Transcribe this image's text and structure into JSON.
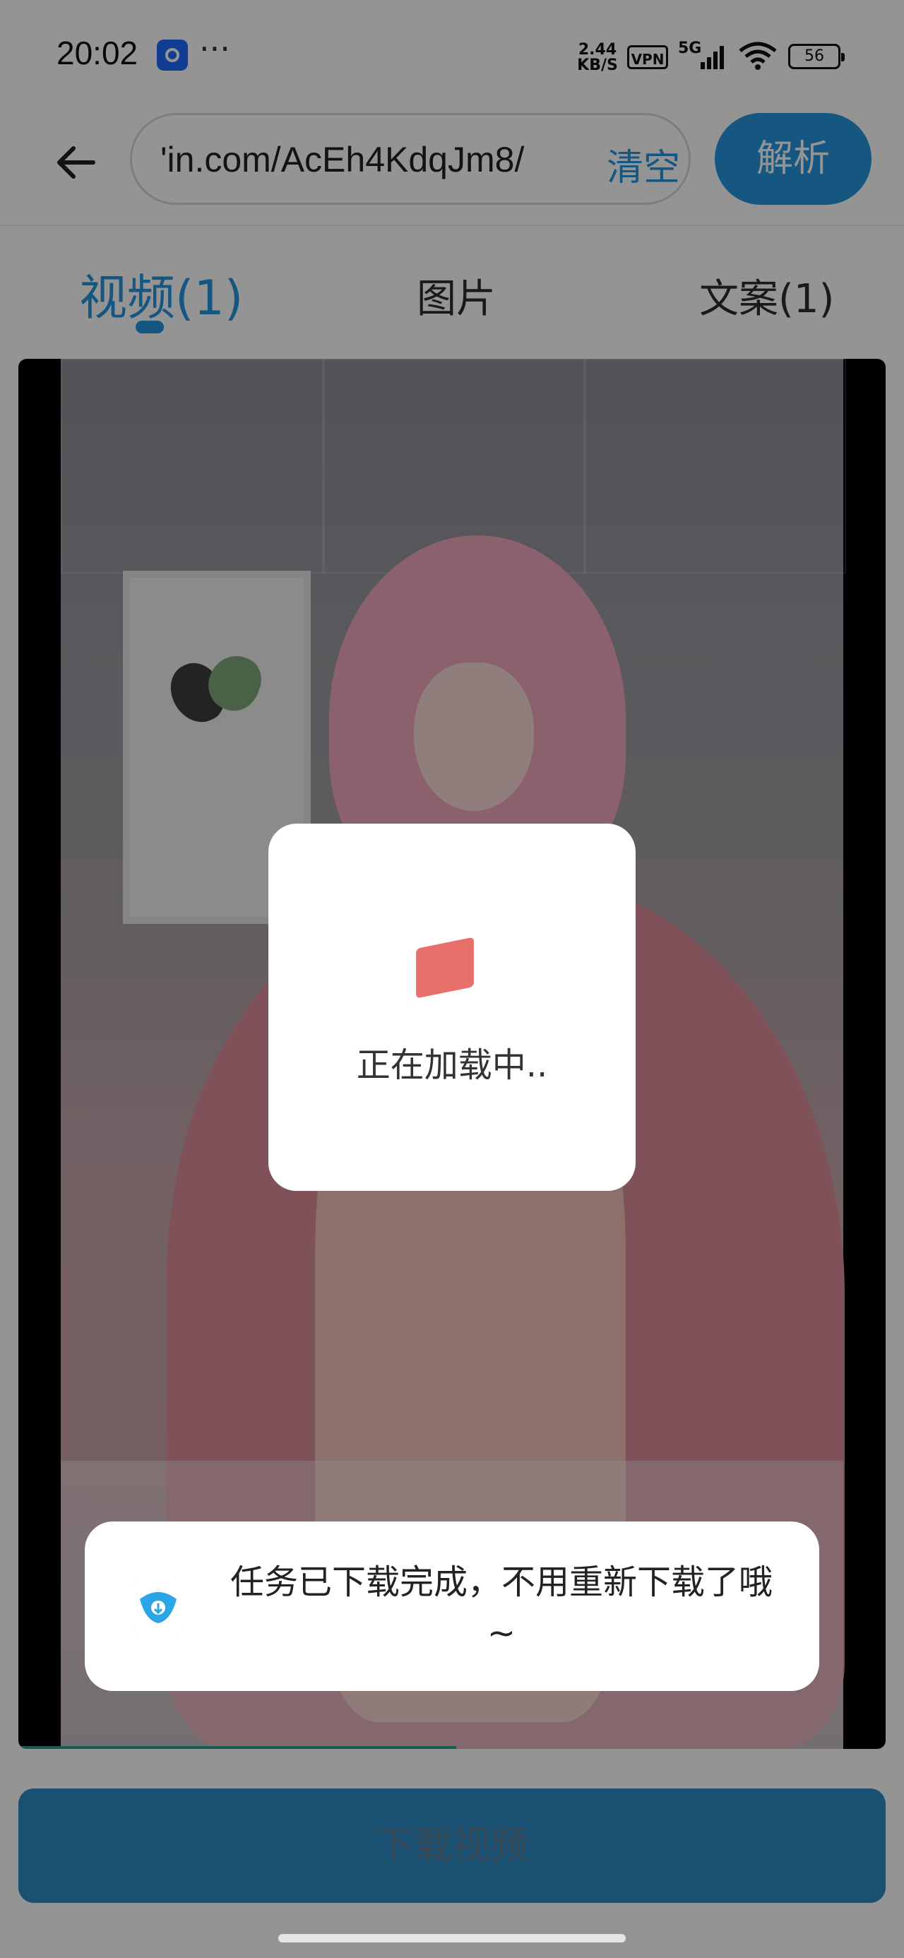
{
  "status_bar": {
    "time": "20:02",
    "more": "···",
    "network_speed": "2.44 KB/S",
    "vpn": "VPN",
    "network_type": "5G",
    "battery": "56"
  },
  "header": {
    "url_value": "'in.com/AcEh4KdqJm8/",
    "clear_label": "清空",
    "parse_label": "解析"
  },
  "tabs": [
    {
      "label": "视频(1)",
      "active": true
    },
    {
      "label": "图片",
      "active": false
    },
    {
      "label": "文案(1)",
      "active": false
    }
  ],
  "loading": {
    "text": "正在加载中.."
  },
  "toast": {
    "text": "任务已下载完成，不用重新下载了哦~"
  },
  "footer": {
    "download_label": "下载视频"
  },
  "colors": {
    "accent": "#2696de",
    "download_button": "#2d8ac4",
    "loading_shape": "#e9706a"
  }
}
